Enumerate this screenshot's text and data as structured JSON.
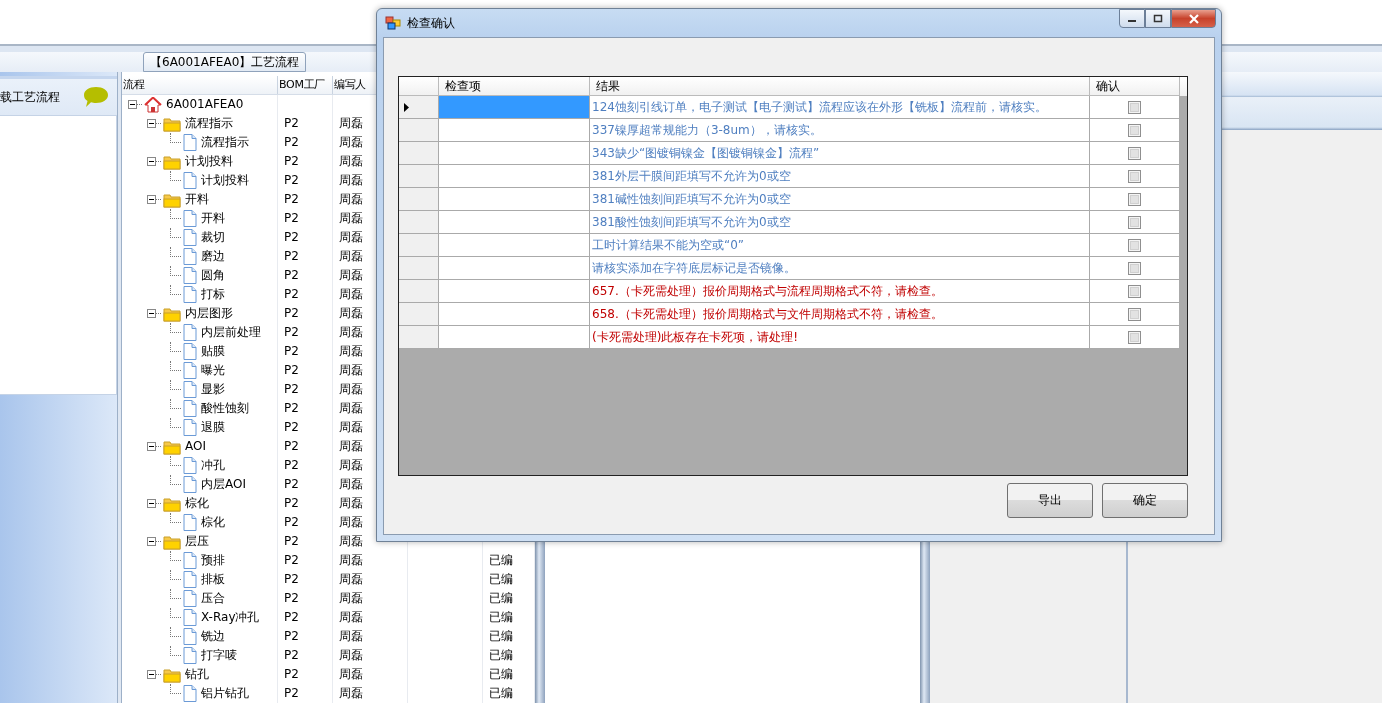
{
  "app": {
    "tab": "【6A001AFEA0】工艺流程",
    "left_panel": {
      "title": "载工艺流程"
    },
    "tree_grid": {
      "columns": [
        "流程",
        "BOM工厂",
        "编写人"
      ],
      "root": {
        "label": "6A001AFEA0",
        "expanded": true,
        "children": [
          {
            "label": "流程指示",
            "bom": "P2",
            "author": "周磊",
            "expanded": true,
            "children": [
              {
                "label": "流程指示",
                "bom": "P2",
                "author": "周磊"
              }
            ]
          },
          {
            "label": "计划投料",
            "bom": "P2",
            "author": "周磊",
            "expanded": true,
            "children": [
              {
                "label": "计划投料",
                "bom": "P2",
                "author": "周磊"
              }
            ]
          },
          {
            "label": "开料",
            "bom": "P2",
            "author": "周磊",
            "expanded": true,
            "children": [
              {
                "label": "开料",
                "bom": "P2",
                "author": "周磊"
              },
              {
                "label": "裁切",
                "bom": "P2",
                "author": "周磊"
              },
              {
                "label": "磨边",
                "bom": "P2",
                "author": "周磊"
              },
              {
                "label": "圆角",
                "bom": "P2",
                "author": "周磊"
              },
              {
                "label": "打标",
                "bom": "P2",
                "author": "周磊"
              }
            ]
          },
          {
            "label": "内层图形",
            "bom": "P2",
            "author": "周磊",
            "expanded": true,
            "children": [
              {
                "label": "内层前处理",
                "bom": "P2",
                "author": "周磊"
              },
              {
                "label": "贴膜",
                "bom": "P2",
                "author": "周磊"
              },
              {
                "label": "曝光",
                "bom": "P2",
                "author": "周磊"
              },
              {
                "label": "显影",
                "bom": "P2",
                "author": "周磊"
              },
              {
                "label": "酸性蚀刻",
                "bom": "P2",
                "author": "周磊"
              },
              {
                "label": "退膜",
                "bom": "P2",
                "author": "周磊"
              }
            ]
          },
          {
            "label": "AOI",
            "bom": "P2",
            "author": "周磊",
            "expanded": true,
            "children": [
              {
                "label": "冲孔",
                "bom": "P2",
                "author": "周磊"
              },
              {
                "label": "内层AOI",
                "bom": "P2",
                "author": "周磊"
              }
            ]
          },
          {
            "label": "棕化",
            "bom": "P2",
            "author": "周磊",
            "expanded": true,
            "children": [
              {
                "label": "棕化",
                "bom": "P2",
                "author": "周磊"
              }
            ]
          },
          {
            "label": "层压",
            "bom": "P2",
            "author": "周磊",
            "expanded": true,
            "children": [
              {
                "label": "预排",
                "bom": "P2",
                "author": "周磊",
                "status": "已编"
              },
              {
                "label": "排板",
                "bom": "P2",
                "author": "周磊",
                "status": "已编"
              },
              {
                "label": "压合",
                "bom": "P2",
                "author": "周磊",
                "status": "已编"
              },
              {
                "label": "X-Ray冲孔",
                "bom": "P2",
                "author": "周磊",
                "status": "已编"
              },
              {
                "label": "铣边",
                "bom": "P2",
                "author": "周磊",
                "status": "已编"
              },
              {
                "label": "打字唛",
                "bom": "P2",
                "author": "周磊",
                "status": "已编"
              }
            ]
          },
          {
            "label": "钻孔",
            "bom": "P2",
            "author": "周磊",
            "status": "已编",
            "expanded": true,
            "children": [
              {
                "label": "铝片钻孔",
                "bom": "P2",
                "author": "周磊",
                "status": "已编"
              }
            ]
          }
        ]
      }
    }
  },
  "dialog": {
    "title": "检查确认",
    "columns": [
      "检查项",
      "结果",
      "确认"
    ],
    "rows": [
      {
        "result": "124蚀刻引线订单，电子测试【电子测试】流程应该在外形【铣板】流程前，请核实。",
        "color": "#4f7fc0",
        "checked": false,
        "selected": true
      },
      {
        "result": "337镍厚超常规能力（3-8um），请核实。",
        "color": "#4f7fc0",
        "checked": false,
        "selected": false
      },
      {
        "result": "343缺少“图镀铜镍金【图镀铜镍金】流程”",
        "color": "#4f7fc0",
        "checked": false,
        "selected": false
      },
      {
        "result": "381外层干膜间距填写不允许为0或空",
        "color": "#4f7fc0",
        "checked": false,
        "selected": false
      },
      {
        "result": "381碱性蚀刻间距填写不允许为0或空",
        "color": "#4f7fc0",
        "checked": false,
        "selected": false
      },
      {
        "result": "381酸性蚀刻间距填写不允许为0或空",
        "color": "#4f7fc0",
        "checked": false,
        "selected": false
      },
      {
        "result": "工时计算结果不能为空或“0”",
        "color": "#4f7fc0",
        "checked": false,
        "selected": false
      },
      {
        "result": "请核实添加在字符底层标记是否镜像。",
        "color": "#4f7fc0",
        "checked": false,
        "selected": false
      },
      {
        "result": "657.（卡死需处理）报价周期格式与流程周期格式不符，请检查。",
        "color": "#c00000",
        "checked": false,
        "selected": false
      },
      {
        "result": "658.（卡死需处理）报价周期格式与文件周期格式不符，请检查。",
        "color": "#c00000",
        "checked": false,
        "selected": false
      },
      {
        "result": "(卡死需处理)此板存在卡死项，请处理!",
        "color": "#c00000",
        "checked": false,
        "selected": false
      }
    ],
    "buttons": [
      "导出",
      "确定"
    ]
  }
}
